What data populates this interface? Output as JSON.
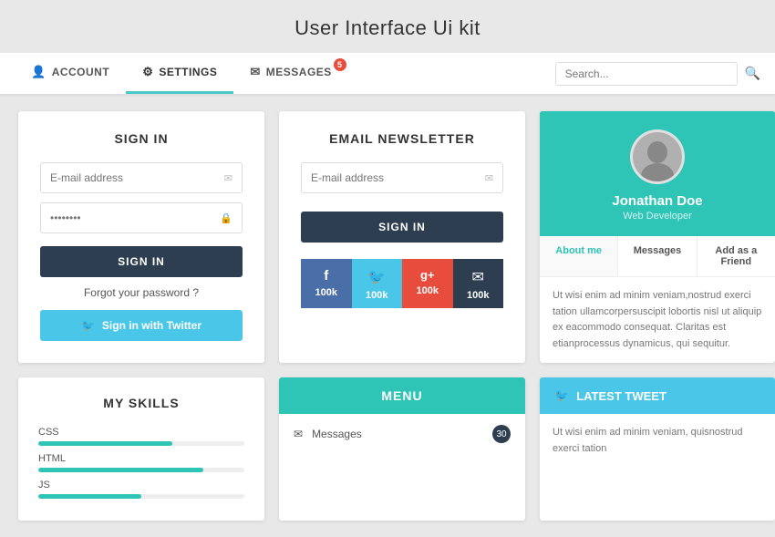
{
  "page": {
    "title": "User Interface Ui kit"
  },
  "tabs": [
    {
      "id": "account",
      "label": "ACCOUNT",
      "icon": "person",
      "active": false
    },
    {
      "id": "settings",
      "label": "SETTINGS",
      "icon": "gear",
      "active": true
    },
    {
      "id": "messages",
      "label": "MESSAGES",
      "icon": "envelope",
      "active": false,
      "badge": "5"
    }
  ],
  "search": {
    "placeholder": "Search..."
  },
  "signin_card": {
    "title": "SIGN IN",
    "email_placeholder": "E-mail address",
    "password_placeholder": "••••••••",
    "signin_btn": "SIGN IN",
    "forgot_text": "Forgot your password ?",
    "twitter_btn": "Sign in with Twitter"
  },
  "newsletter_card": {
    "title": "EMAIL NEWSLETTER",
    "email_placeholder": "E-mail address",
    "signin_btn": "SIGN IN"
  },
  "social_buttons": [
    {
      "id": "facebook",
      "icon": "f",
      "count": "100k",
      "color_class": "facebook"
    },
    {
      "id": "twitter",
      "icon": "t",
      "count": "100k",
      "color_class": "twitter"
    },
    {
      "id": "google",
      "icon": "g+",
      "count": "100k",
      "color_class": "google"
    },
    {
      "id": "email",
      "icon": "✉",
      "count": "100k",
      "color_class": "email"
    }
  ],
  "profile_card": {
    "name": "Jonathan Doe",
    "role": "Web Developer",
    "tabs": [
      "About me",
      "Messages",
      "Add as a Friend"
    ],
    "bio": "Ut wisi enim ad minim veniam,nostrud exerci tation ullamcorpersuscipit lobortis nisl ut aliquip ex eacommodo consequat. Claritas est etianprocessus dynamicus, qui sequitur."
  },
  "skills_card": {
    "title": "MY SKILLS",
    "skills": [
      {
        "label": "CSS",
        "percent": 65
      },
      {
        "label": "HTML",
        "percent": 80
      },
      {
        "label": "JS",
        "percent": 50
      }
    ]
  },
  "menu_card": {
    "title": "MENU",
    "items": [
      {
        "icon": "✉",
        "label": "Messages",
        "badge": "30"
      }
    ]
  },
  "tweet_card": {
    "title": "LATEST TWEET",
    "text": "Ut wisi enim ad minim veniam, quisnostrud exerci tation"
  }
}
